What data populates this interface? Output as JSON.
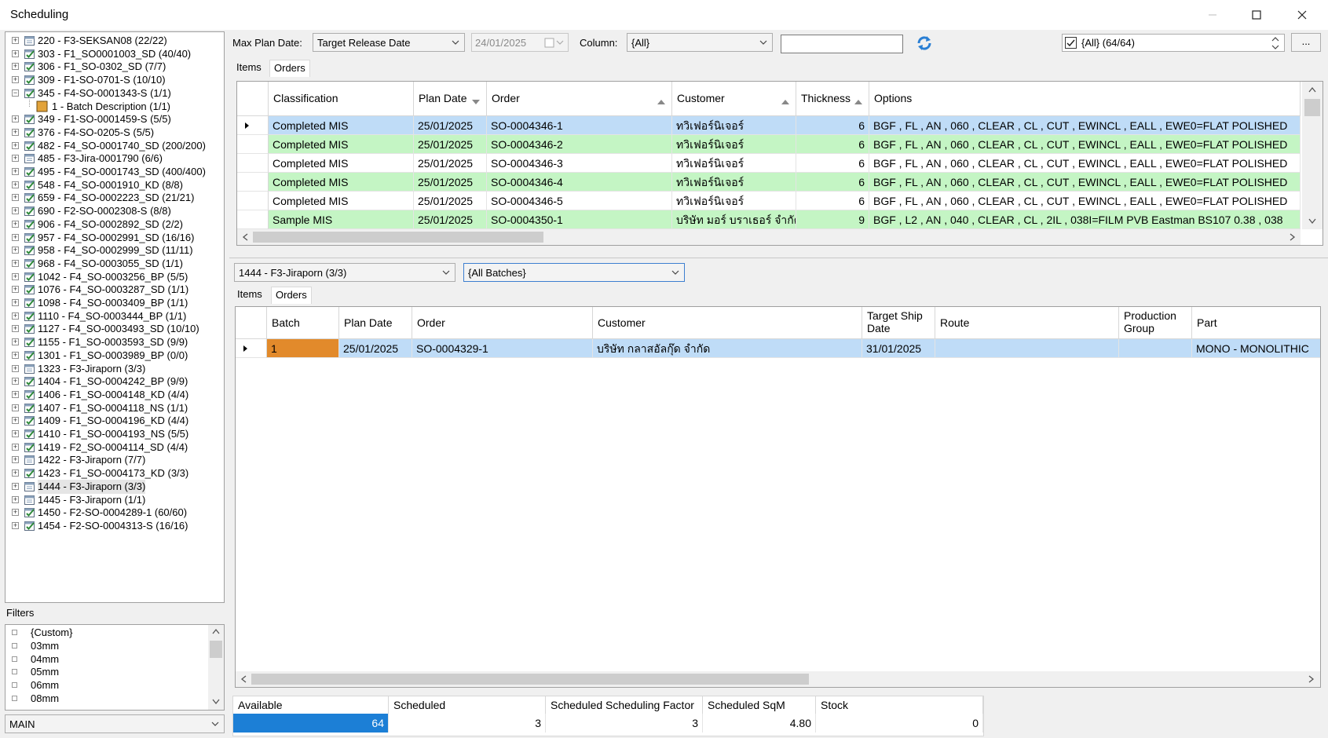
{
  "window": {
    "title": "Scheduling"
  },
  "tree": {
    "items": [
      {
        "label": "220 - F3-SEKSAN08 (22/22)",
        "icon": "calendar-icon"
      },
      {
        "label": "303 - F1_SO0001003_SD (40/40)",
        "icon": "check-calendar-icon"
      },
      {
        "label": "306 - F1_SO-0302_SD (7/7)",
        "icon": "check-calendar-icon"
      },
      {
        "label": "309 - F1-SO-0701-S (10/10)",
        "icon": "check-calendar-icon"
      },
      {
        "label": "345 - F4-SO-0001343-S (1/1)",
        "icon": "check-calendar-icon",
        "expanded": true
      },
      {
        "label": "1 - Batch Description (1/1)",
        "icon": "batch-square-icon",
        "child": true
      },
      {
        "label": "349 - F1-SO-0001459-S (5/5)",
        "icon": "check-calendar-icon"
      },
      {
        "label": "376 - F4-SO-0205-S (5/5)",
        "icon": "check-calendar-icon"
      },
      {
        "label": "482 - F4_SO-0001740_SD (200/200)",
        "icon": "check-calendar-icon"
      },
      {
        "label": "485 - F3-Jira-0001790 (6/6)",
        "icon": "calendar-icon"
      },
      {
        "label": "495 - F4_SO-0001743_SD (400/400)",
        "icon": "check-calendar-icon"
      },
      {
        "label": "548 - F4_SO-0001910_KD (8/8)",
        "icon": "check-calendar-icon"
      },
      {
        "label": "659 - F4_SO-0002223_SD (21/21)",
        "icon": "check-calendar-icon"
      },
      {
        "label": "690 - F2-SO-0002308-S (8/8)",
        "icon": "check-calendar-icon"
      },
      {
        "label": "906 - F4_SO-0002892_SD (2/2)",
        "icon": "check-calendar-icon"
      },
      {
        "label": "957 - F4_SO-0002991_SD (16/16)",
        "icon": "check-calendar-icon"
      },
      {
        "label": "958 - F4_SO-0002999_SD (11/11)",
        "icon": "check-calendar-icon"
      },
      {
        "label": "968 - F4_SO-0003055_SD (1/1)",
        "icon": "check-calendar-icon"
      },
      {
        "label": "1042 - F4_SO-0003256_BP (5/5)",
        "icon": "check-calendar-icon"
      },
      {
        "label": "1076 - F4_SO-0003287_SD (1/1)",
        "icon": "check-calendar-icon"
      },
      {
        "label": "1098 - F4_SO-0003409_BP (1/1)",
        "icon": "check-calendar-icon"
      },
      {
        "label": "1110 - F4_SO-0003444_BP (1/1)",
        "icon": "check-calendar-icon"
      },
      {
        "label": "1127 - F4_SO-0003493_SD (10/10)",
        "icon": "check-calendar-icon"
      },
      {
        "label": "1155 - F1_SO-0003593_SD (9/9)",
        "icon": "check-calendar-icon"
      },
      {
        "label": "1301 - F1_SO-0003989_BP (0/0)",
        "icon": "check-calendar-icon"
      },
      {
        "label": "1323 - F3-Jiraporn (3/3)",
        "icon": "calendar-icon"
      },
      {
        "label": "1404 - F1_SO-0004242_BP (9/9)",
        "icon": "check-calendar-icon"
      },
      {
        "label": "1406 - F1_SO-0004148_KD (4/4)",
        "icon": "check-calendar-icon"
      },
      {
        "label": "1407 - F1_SO-0004118_NS (1/1)",
        "icon": "check-calendar-icon"
      },
      {
        "label": "1409 - F1_SO-0004196_KD (4/4)",
        "icon": "check-calendar-icon"
      },
      {
        "label": "1410 - F1_SO-0004193_NS (5/5)",
        "icon": "check-calendar-icon"
      },
      {
        "label": "1419 - F2_SO-0004114_SD (4/4)",
        "icon": "check-calendar-icon"
      },
      {
        "label": "1422 - F3-Jiraporn (7/7)",
        "icon": "calendar-icon"
      },
      {
        "label": "1423 - F1_SO-0004173_KD (3/3)",
        "icon": "check-calendar-icon"
      },
      {
        "label": "1444 - F3-Jiraporn (3/3)",
        "icon": "calendar-icon",
        "selected": true
      },
      {
        "label": "1445 - F3-Jiraporn (1/1)",
        "icon": "calendar-icon"
      },
      {
        "label": "1450 - F2-SO-0004289-1 (60/60)",
        "icon": "check-calendar-icon"
      },
      {
        "label": "1454 - F2-SO-0004313-S (16/16)",
        "icon": "check-calendar-icon"
      }
    ]
  },
  "filters": {
    "label": "Filters",
    "items": [
      "{Custom}",
      "03mm",
      "04mm",
      "05mm",
      "06mm",
      "08mm"
    ],
    "bottom_combo": "MAIN"
  },
  "toolbar": {
    "max_plan_date_label": "Max Plan Date:",
    "max_plan_date_mode": "Target Release Date",
    "date_value": "24/01/2025",
    "column_label": "Column:",
    "column_value": "{All}",
    "search_value": "",
    "refresh_icon": "refresh-icon",
    "all_filter": "{All}  (64/64)",
    "more_button": "..."
  },
  "top_tabs": {
    "items": "Items",
    "orders": "Orders"
  },
  "top_grid": {
    "columns": [
      "Classification",
      "Plan Date",
      "Order",
      "Customer",
      "Thickness",
      "Options"
    ],
    "rows": [
      {
        "classification": "Completed MIS",
        "plan_date": "25/01/2025",
        "order": "SO-0004346-1",
        "customer": "ทวิเฟอร์นิเจอร์",
        "thickness": "6",
        "options": "BGF , FL , AN , 060 , CLEAR , CL , CUT , EWINCL , EALL , EWE0=FLAT POLISHED"
      },
      {
        "classification": "Completed MIS",
        "plan_date": "25/01/2025",
        "order": "SO-0004346-2",
        "customer": "ทวิเฟอร์นิเจอร์",
        "thickness": "6",
        "options": "BGF , FL , AN , 060 , CLEAR , CL , CUT , EWINCL , EALL , EWE0=FLAT POLISHED"
      },
      {
        "classification": "Completed MIS",
        "plan_date": "25/01/2025",
        "order": "SO-0004346-3",
        "customer": "ทวิเฟอร์นิเจอร์",
        "thickness": "6",
        "options": "BGF , FL , AN , 060 , CLEAR , CL , CUT , EWINCL , EALL , EWE0=FLAT POLISHED"
      },
      {
        "classification": "Completed MIS",
        "plan_date": "25/01/2025",
        "order": "SO-0004346-4",
        "customer": "ทวิเฟอร์นิเจอร์",
        "thickness": "6",
        "options": "BGF , FL , AN , 060 , CLEAR , CL , CUT , EWINCL , EALL , EWE0=FLAT POLISHED"
      },
      {
        "classification": "Completed MIS",
        "plan_date": "25/01/2025",
        "order": "SO-0004346-5",
        "customer": "ทวิเฟอร์นิเจอร์",
        "thickness": "6",
        "options": "BGF , FL , AN , 060 , CLEAR , CL , CUT , EWINCL , EALL , EWE0=FLAT POLISHED"
      },
      {
        "classification": "Sample MIS",
        "plan_date": "25/01/2025",
        "order": "SO-0004350-1",
        "customer": "บริษัท มอร์ บราเธอร์ จำกัด",
        "thickness": "9",
        "options": "BGF , L2 , AN , 040 , CLEAR , CL , 2IL , 038I=FILM PVB Eastman BS107 0.38 , 038"
      }
    ]
  },
  "batch_panel": {
    "schedule_combo": "1444 - F3-Jiraporn (3/3)",
    "batch_combo": "{All Batches}",
    "tabs": {
      "items": "Items",
      "orders": "Orders"
    },
    "columns": [
      "Batch",
      "Plan Date",
      "Order",
      "Customer",
      "Target Ship Date",
      "Route",
      "Production Group",
      "Part"
    ],
    "rows": [
      {
        "batch": "1",
        "plan_date": "25/01/2025",
        "order": "SO-0004329-1",
        "customer": "บริษัท กลาสอัลกุ๊ด  จำกัด",
        "target_ship_date": "31/01/2025",
        "route": "",
        "production_group": "",
        "part": "MONO - MONOLITHIC"
      }
    ]
  },
  "summary": {
    "columns": [
      "Available",
      "Scheduled",
      "Scheduled Scheduling Factor",
      "Scheduled SqM",
      "Stock"
    ],
    "values": [
      "64",
      "3",
      "3",
      "4.80",
      "0"
    ]
  },
  "colors": {
    "selected_row": "#bfdcf7",
    "alt_row": "#c4f5c4",
    "batch_orange": "#e28a2b",
    "available_blue": "#1c7fd6"
  }
}
